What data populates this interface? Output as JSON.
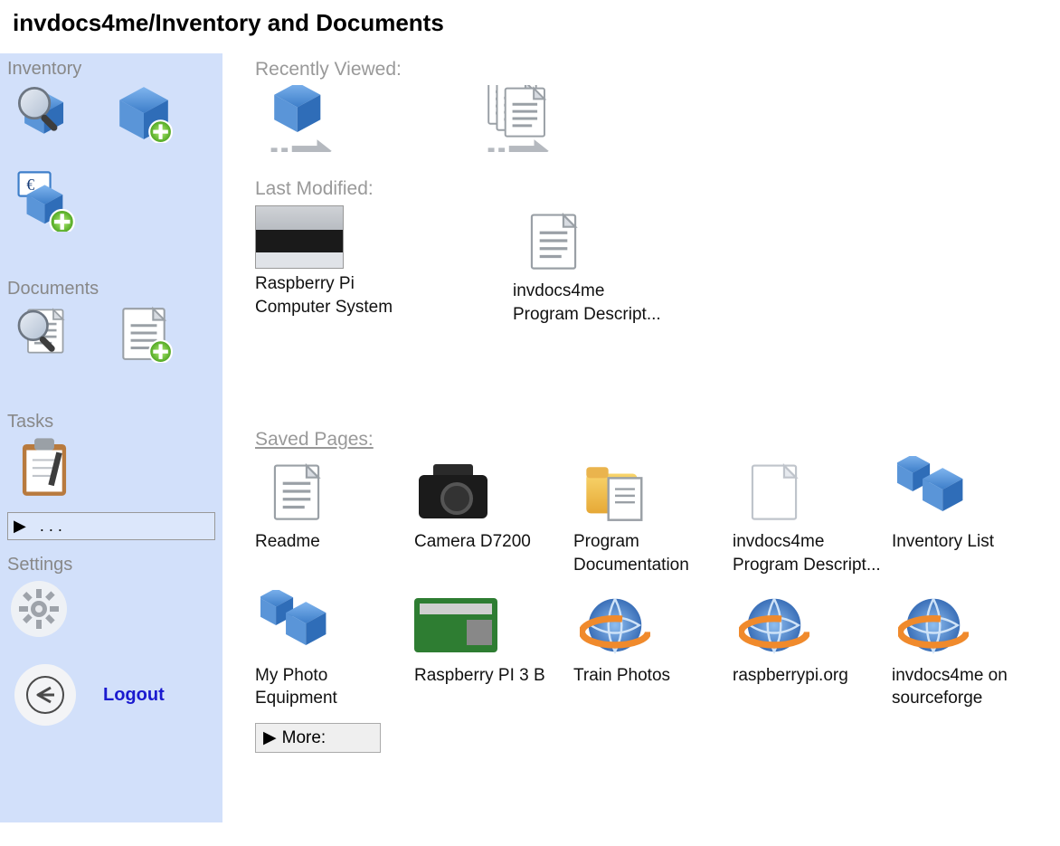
{
  "title": "invdocs4me/Inventory and Documents",
  "sidebar": {
    "inventory_label": "Inventory",
    "documents_label": "Documents",
    "tasks_label": "Tasks",
    "settings_label": "Settings",
    "expander_label": " .  .  .",
    "logout_label": "Logout"
  },
  "main": {
    "recently_viewed_label": "Recently Viewed:",
    "last_modified_label": "Last Modified:",
    "saved_pages_label": "Saved Pages:",
    "more_label": "More:",
    "last_modified": [
      {
        "label": "Raspberry Pi Computer System",
        "icon": "photo"
      },
      {
        "label": "invdocs4me Program Descript...",
        "icon": "document"
      }
    ],
    "saved_pages": [
      {
        "label": "Readme",
        "icon": "document"
      },
      {
        "label": "Camera D7200",
        "icon": "camera"
      },
      {
        "label": "Program Documentation",
        "icon": "folder-doc"
      },
      {
        "label": "invdocs4me Program Descript...",
        "icon": "document-blank"
      },
      {
        "label": "Inventory List",
        "icon": "cubes"
      },
      {
        "label": "My Photo Equipment",
        "icon": "cubes"
      },
      {
        "label": "Raspberry PI 3 B",
        "icon": "board"
      },
      {
        "label": "Train Photos",
        "icon": "globe"
      },
      {
        "label": "raspberrypi.org",
        "icon": "globe"
      },
      {
        "label": "invdocs4me on sourceforge",
        "icon": "globe"
      }
    ]
  }
}
